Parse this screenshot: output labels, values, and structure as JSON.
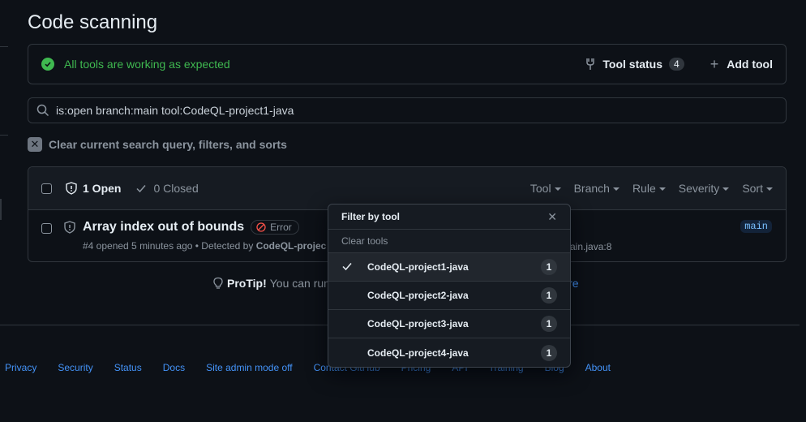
{
  "page": {
    "title": "Code scanning"
  },
  "tools_bar": {
    "status_text": "All tools are working as expected",
    "tool_status_label": "Tool status",
    "tool_status_count": "4",
    "add_tool_label": "Add tool",
    "status_color": "#3fb950"
  },
  "search": {
    "value": "is:open branch:main tool:CodeQL-project1-java"
  },
  "clear_query": {
    "label": "Clear current search query, filters, and sorts"
  },
  "results": {
    "open_label": "1 Open",
    "closed_label": "0 Closed",
    "filters": [
      "Tool",
      "Branch",
      "Rule",
      "Severity",
      "Sort"
    ],
    "alert": {
      "title": "Array index out of bounds",
      "severity": "Error",
      "meta_prefix": "#4 opened 5 minutes ago • Detected by ",
      "detector": "CodeQL-projec",
      "file_ref": "ain.java:8",
      "branch": "main"
    }
  },
  "protip": {
    "label": "ProTip!",
    "text": "You can run",
    "link": "n more"
  },
  "footer": {
    "links": [
      "Privacy",
      "Security",
      "Status",
      "Docs",
      "Site admin mode off",
      "Contact GitHub",
      "Pricing",
      "API",
      "Training",
      "Blog",
      "About"
    ]
  },
  "dropdown": {
    "title": "Filter by tool",
    "clear_label": "Clear tools",
    "items": [
      {
        "label": "CodeQL-project1-java",
        "count": "1",
        "selected": true
      },
      {
        "label": "CodeQL-project2-java",
        "count": "1",
        "selected": false
      },
      {
        "label": "CodeQL-project3-java",
        "count": "1",
        "selected": false
      },
      {
        "label": "CodeQL-project4-java",
        "count": "1",
        "selected": false
      }
    ]
  }
}
